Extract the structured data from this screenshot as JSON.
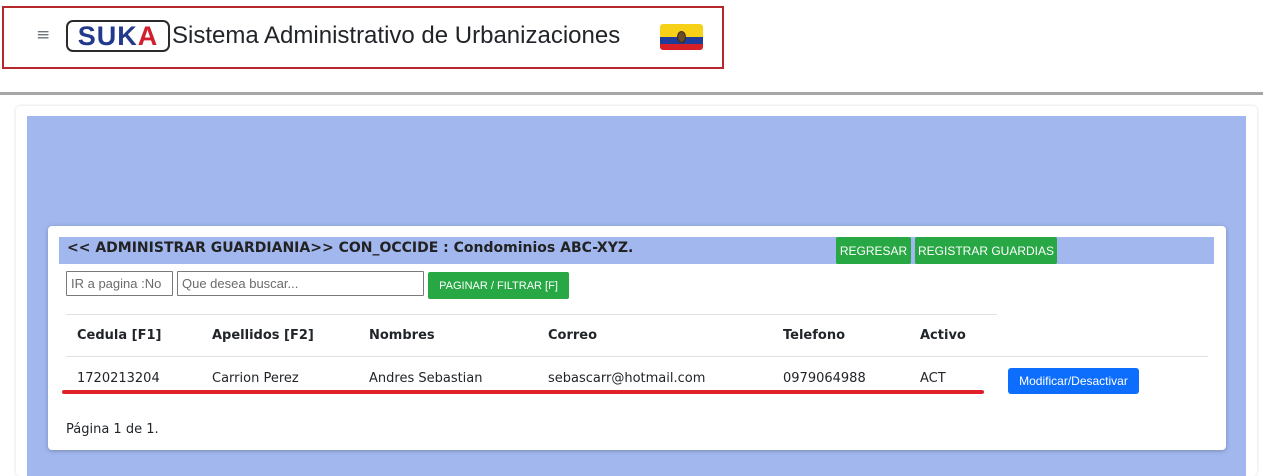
{
  "header": {
    "menu_icon": "hamburger-icon",
    "logo": {
      "part1": "SUK",
      "part2": "A"
    },
    "app_title": "Sistema Administrativo de Urbanizaciones",
    "flag_icon": "ecuador-flag-icon"
  },
  "panel": {
    "title": "<< ADMINISTRAR GUARDIANIA>> CON_OCCIDE : Condominios ABC-XYZ.",
    "regresar_label": "REGRESAR",
    "registrar_label": "REGISTRAR GUARDIAS",
    "page_input_placeholder": "IR a pagina :No",
    "search_placeholder": "Que desea buscar...",
    "filter_label": "PAGINAR / FILTRAR [F]"
  },
  "table": {
    "headers": [
      "Cedula [F1]",
      "Apellidos [F2]",
      "Nombres",
      "Correo",
      "Telefono",
      "Activo"
    ],
    "rows": [
      {
        "cedula": "1720213204",
        "apellidos": "Carrion Perez",
        "nombres": "Andres Sebastian",
        "correo": "sebascarr@hotmail.com",
        "telefono": "0979064988",
        "activo": "ACT",
        "action_label": "Modificar/Desactivar"
      }
    ]
  },
  "pagination": {
    "text": "Página 1 de 1."
  },
  "colors": {
    "accent_blue": "#a1b7ee",
    "green": "#28a745",
    "primary": "#0d6efd",
    "highlight_red": "#e0202a"
  }
}
